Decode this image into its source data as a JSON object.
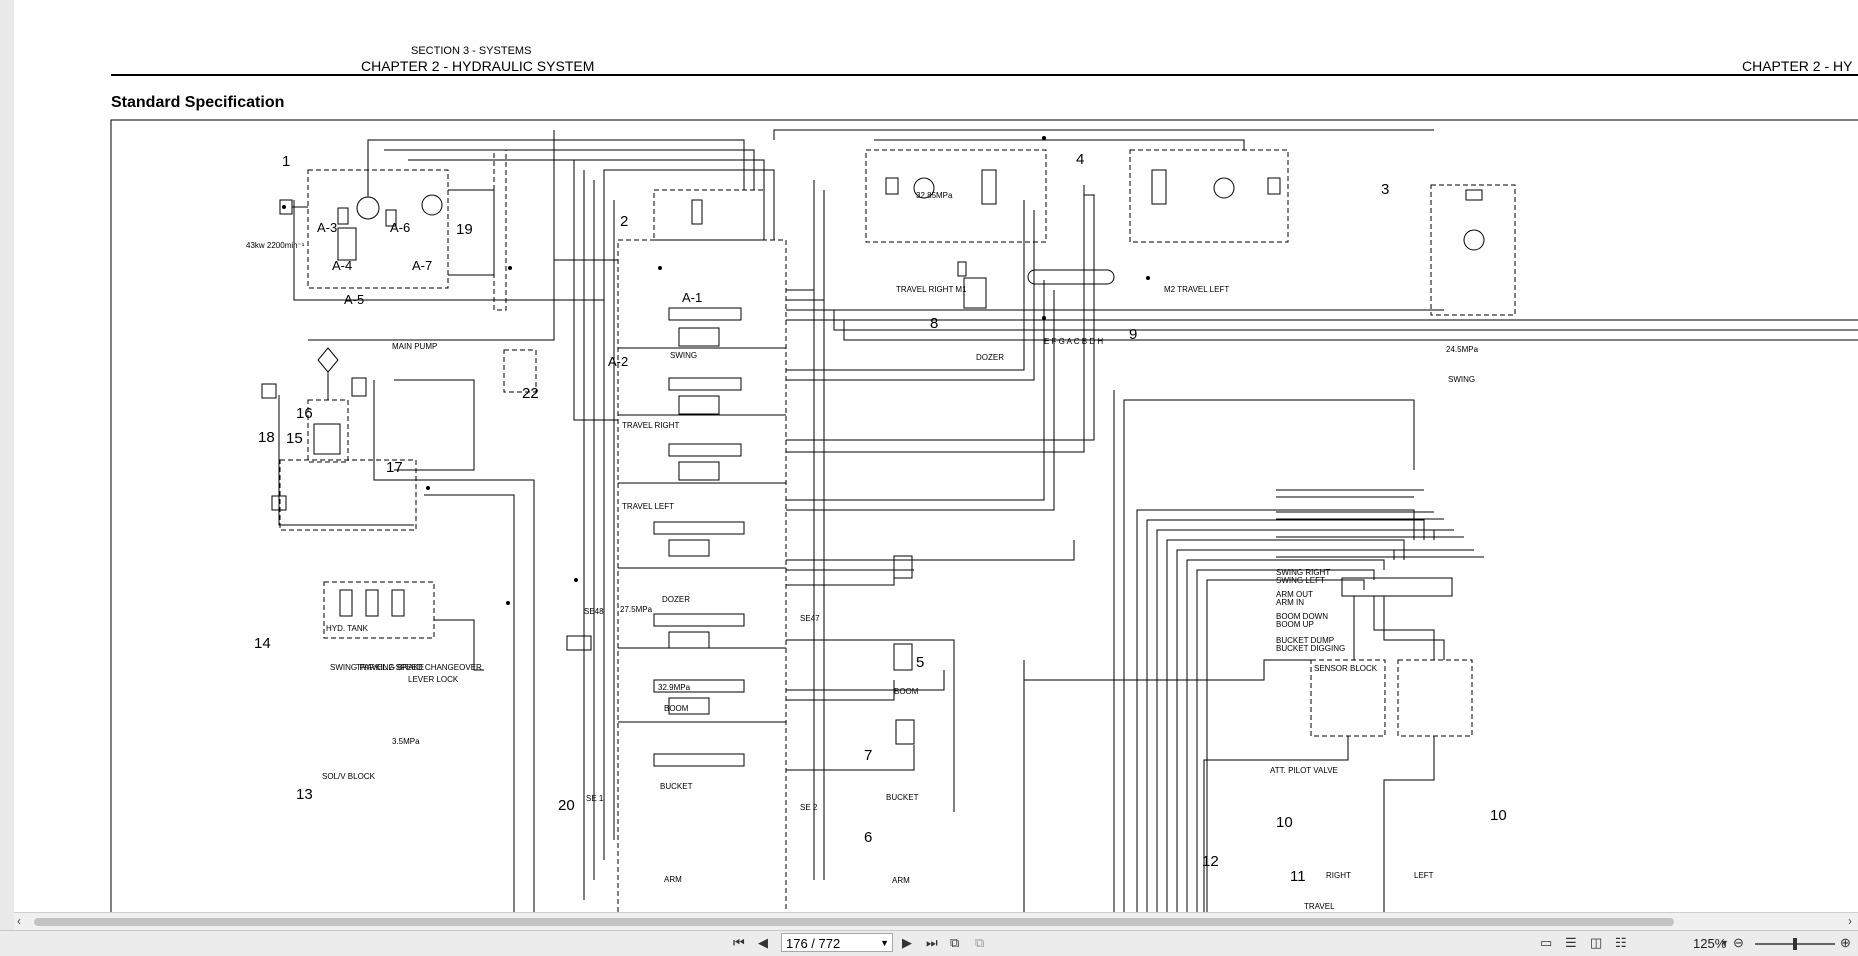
{
  "document": {
    "section": "SECTION 3 - SYSTEMS",
    "chapter_left": "CHAPTER 2 - HYDRAULIC SYSTEM",
    "chapter_right": "CHAPTER 2 - HY",
    "heading": "Standard Specification"
  },
  "diagram": {
    "numbers": [
      "1",
      "2",
      "3",
      "4",
      "5",
      "6",
      "7",
      "8",
      "9",
      "10",
      "11",
      "12",
      "13",
      "14",
      "15",
      "16",
      "17",
      "18",
      "19",
      "20",
      "22"
    ],
    "main_pump": "MAIN PUMP",
    "engine": "43kw 2200min⁻¹",
    "pump_ports": [
      "A-3",
      "A-6",
      "A-4",
      "A-7",
      "A-5"
    ],
    "control_valve_ports": [
      "A-1",
      "A-2"
    ],
    "sections": [
      "SWING",
      "TRAVEL RIGHT",
      "TRAVEL LEFT",
      "DOZER",
      "BOOM",
      "BUCKET",
      "ARM"
    ],
    "travel_right_motor": "TRAVEL RIGHT M1",
    "travel_left_motor": "M2 TRAVEL LEFT",
    "swing_motor": "SWING",
    "dozer_cyl": "DOZER",
    "boom_cyl": "BOOM",
    "bucket_cyl": "BUCKET",
    "arm_cyl": "ARM",
    "hyd_tank": "HYD. TANK",
    "sol_block": "SOL/V BLOCK",
    "sol_labels": [
      "SWING PARKING BRAKE",
      "TRAVEL 2-SPEED CHANGEOVER",
      "LEVER LOCK"
    ],
    "swivel_ports": "E F G A C B D H",
    "sensor_block": "SENSOR BLOCK",
    "pilot_valve": "ATT. PILOT VALVE",
    "pilot_right": "RIGHT",
    "pilot_left": "LEFT",
    "travel_label": "TRAVEL",
    "pilot_lines": [
      "SWING RIGHT",
      "SWING LEFT",
      "ARM OUT",
      "ARM IN",
      "BOOM DOWN",
      "BOOM UP",
      "BUCKET DUMP",
      "BUCKET DIGGING"
    ],
    "sensors": [
      "SE48",
      "SE47",
      "SE 1",
      "SE 2"
    ],
    "pressures": [
      "32.85MPa",
      "27.5MPa",
      "32.9MPa",
      "24.5MPa",
      "3.5MPa"
    ]
  },
  "viewer": {
    "page_indicator": "176 / 772",
    "zoom": "125%"
  },
  "colors": {
    "toolbar": "#ececec",
    "page": "#ffffff",
    "ink": "#000000"
  }
}
